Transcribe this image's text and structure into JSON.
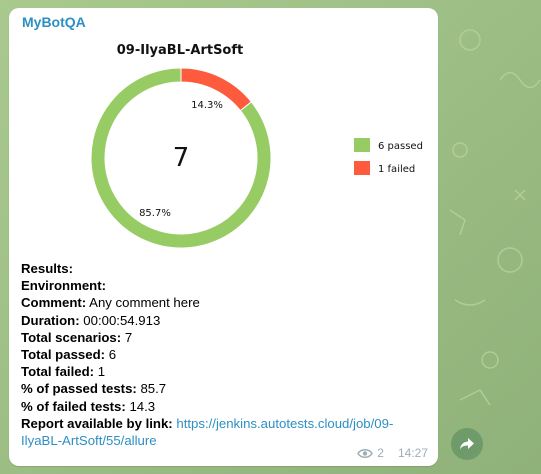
{
  "message": {
    "sender": "MyBotQA",
    "time": "14:27",
    "views": "2",
    "lines": [
      {
        "label": "Results:",
        "value": ""
      },
      {
        "label": "Environment:",
        "value": ""
      },
      {
        "label": "Comment:",
        "value": "Any comment here"
      },
      {
        "label": "Duration:",
        "value": "00:00:54.913"
      },
      {
        "label": "Total scenarios:",
        "value": "7"
      },
      {
        "label": "Total passed:",
        "value": "6"
      },
      {
        "label": "Total failed:",
        "value": "1"
      },
      {
        "label": "% of passed tests:",
        "value": "85.7"
      },
      {
        "label": "% of failed tests:",
        "value": "14.3"
      }
    ],
    "report_label": "Report available by link:",
    "report_link": "https://jenkins.autotests.cloud/job/09-IlyaBL-ArtSoft/55/allure"
  },
  "colors": {
    "passed": "#97cc64",
    "failed": "#fd5a3e",
    "link": "#2d8fc3",
    "wallpaper": "#9fbf86"
  },
  "icons": {
    "views": "eye-icon",
    "share": "share-arrow-icon"
  },
  "chart_data": {
    "type": "pie",
    "title": "09-IlyaBL-ArtSoft",
    "center_label": "7",
    "slices": [
      {
        "label": "6 passed",
        "value": 6,
        "percent_label": "85.7%",
        "color": "#97cc64"
      },
      {
        "label": "1 failed",
        "value": 1,
        "percent_label": "14.3%",
        "color": "#fd5a3e"
      }
    ],
    "legend_position": "right"
  }
}
